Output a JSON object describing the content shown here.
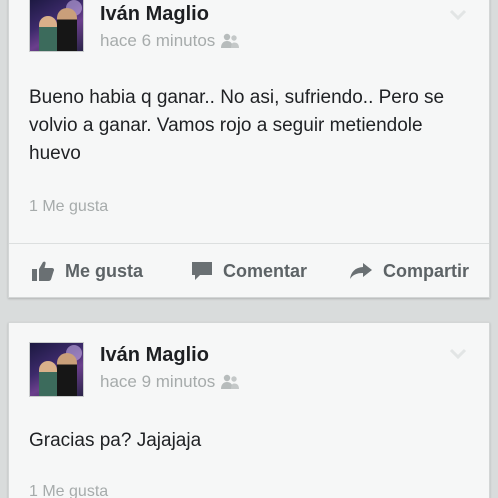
{
  "posts": [
    {
      "author": "Iván Maglio",
      "time": "hace 6 minutos",
      "text": "Bueno habia q ganar.. No asi, sufriendo.. Pero se volvio a ganar. Vamos rojo a seguir metiendole huevo",
      "likes": "1 Me gusta",
      "actions": {
        "like": "Me gusta",
        "comment": "Comentar",
        "share": "Compartir"
      }
    },
    {
      "author": "Iván Maglio",
      "time": "hace 9 minutos",
      "text": "Gracias pa? Jajajaja",
      "likes": "1 Me gusta"
    }
  ],
  "icons": {
    "privacy": "friends-icon",
    "menu": "chevron-down-icon",
    "like": "thumbs-up-icon",
    "comment": "comment-icon",
    "share": "share-arrow-icon"
  },
  "colors": {
    "background": "#d9dcdc",
    "card": "#f6f7f7",
    "text": "#1f2124",
    "muted": "#a6abab",
    "action": "#5d6366"
  }
}
